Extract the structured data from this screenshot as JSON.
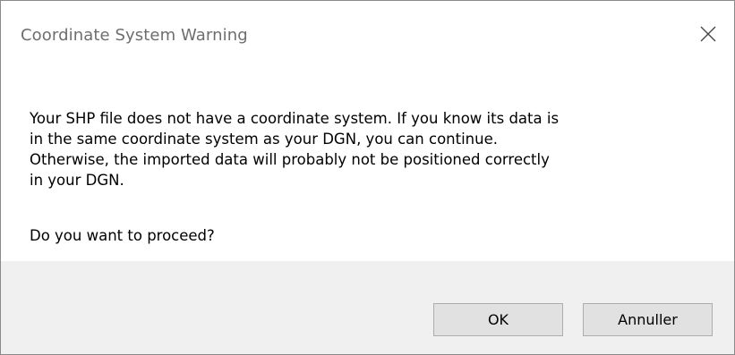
{
  "window": {
    "title": "Coordinate System Warning",
    "close_icon": "close-icon"
  },
  "message": {
    "lines": [
      "Your SHP file does not have a coordinate system. If you know its data is",
      "in the same coordinate system as your DGN, you can continue.",
      "Otherwise, the imported data will probably not be positioned correctly",
      "in your DGN."
    ],
    "question": "Do you want to proceed?"
  },
  "buttons": {
    "ok_label": "OK",
    "cancel_label": "Annuller"
  },
  "colors": {
    "footer_background": "#f0f0f0",
    "button_background": "#e1e1e1",
    "button_border": "#adadad",
    "title_text": "#6e6e6e"
  }
}
